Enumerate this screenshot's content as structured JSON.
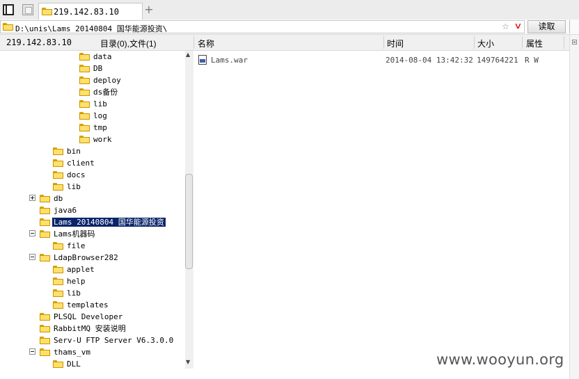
{
  "tab_bar": {
    "active_tab_label": "219.142.83.10",
    "new_tab_symbol": "+"
  },
  "address_bar": {
    "path": "D:\\unis\\Lams 20140804 国华能源投资\\",
    "star_symbol": "☆",
    "read_button_label": "读取"
  },
  "header": {
    "host": "219.142.83.10",
    "summary": "目录(0),文件(1)",
    "columns": {
      "name": "名称",
      "time": "时间",
      "size": "大小",
      "attributes": "属性"
    }
  },
  "tree": {
    "items": [
      {
        "label": "data"
      },
      {
        "label": "DB"
      },
      {
        "label": "deploy"
      },
      {
        "label": "ds备份"
      },
      {
        "label": "lib"
      },
      {
        "label": "log"
      },
      {
        "label": "tmp"
      },
      {
        "label": "work"
      },
      {
        "label": "bin"
      },
      {
        "label": "client"
      },
      {
        "label": "docs"
      },
      {
        "label": "lib"
      },
      {
        "label": "db",
        "expander": "+"
      },
      {
        "label": "java6"
      },
      {
        "label": "Lams 20140804 国华能源投资",
        "selected": true
      },
      {
        "label": "Lams机器码",
        "expander": "-"
      },
      {
        "label": "file"
      },
      {
        "label": "LdapBrowser282",
        "expander": "-"
      },
      {
        "label": "applet"
      },
      {
        "label": "help"
      },
      {
        "label": "lib"
      },
      {
        "label": "templates"
      },
      {
        "label": "PLSQL Developer"
      },
      {
        "label": "RabbitMQ 安装说明"
      },
      {
        "label": "Serv-U FTP Server V6.3.0.0"
      },
      {
        "label": "thams_vm",
        "expander": "-"
      },
      {
        "label": "DLL"
      }
    ]
  },
  "files": [
    {
      "name": "Lams.war",
      "time": "2014-08-04 13:42:32",
      "size": "149764221",
      "attributes": "R W",
      "icon": "war-file-icon"
    }
  ],
  "watermark": "www.wooyun.org",
  "colors": {
    "selection_bg": "#0a246a",
    "folder_fill": "#ffe06a",
    "dropdown_arrow": "#d11111"
  }
}
